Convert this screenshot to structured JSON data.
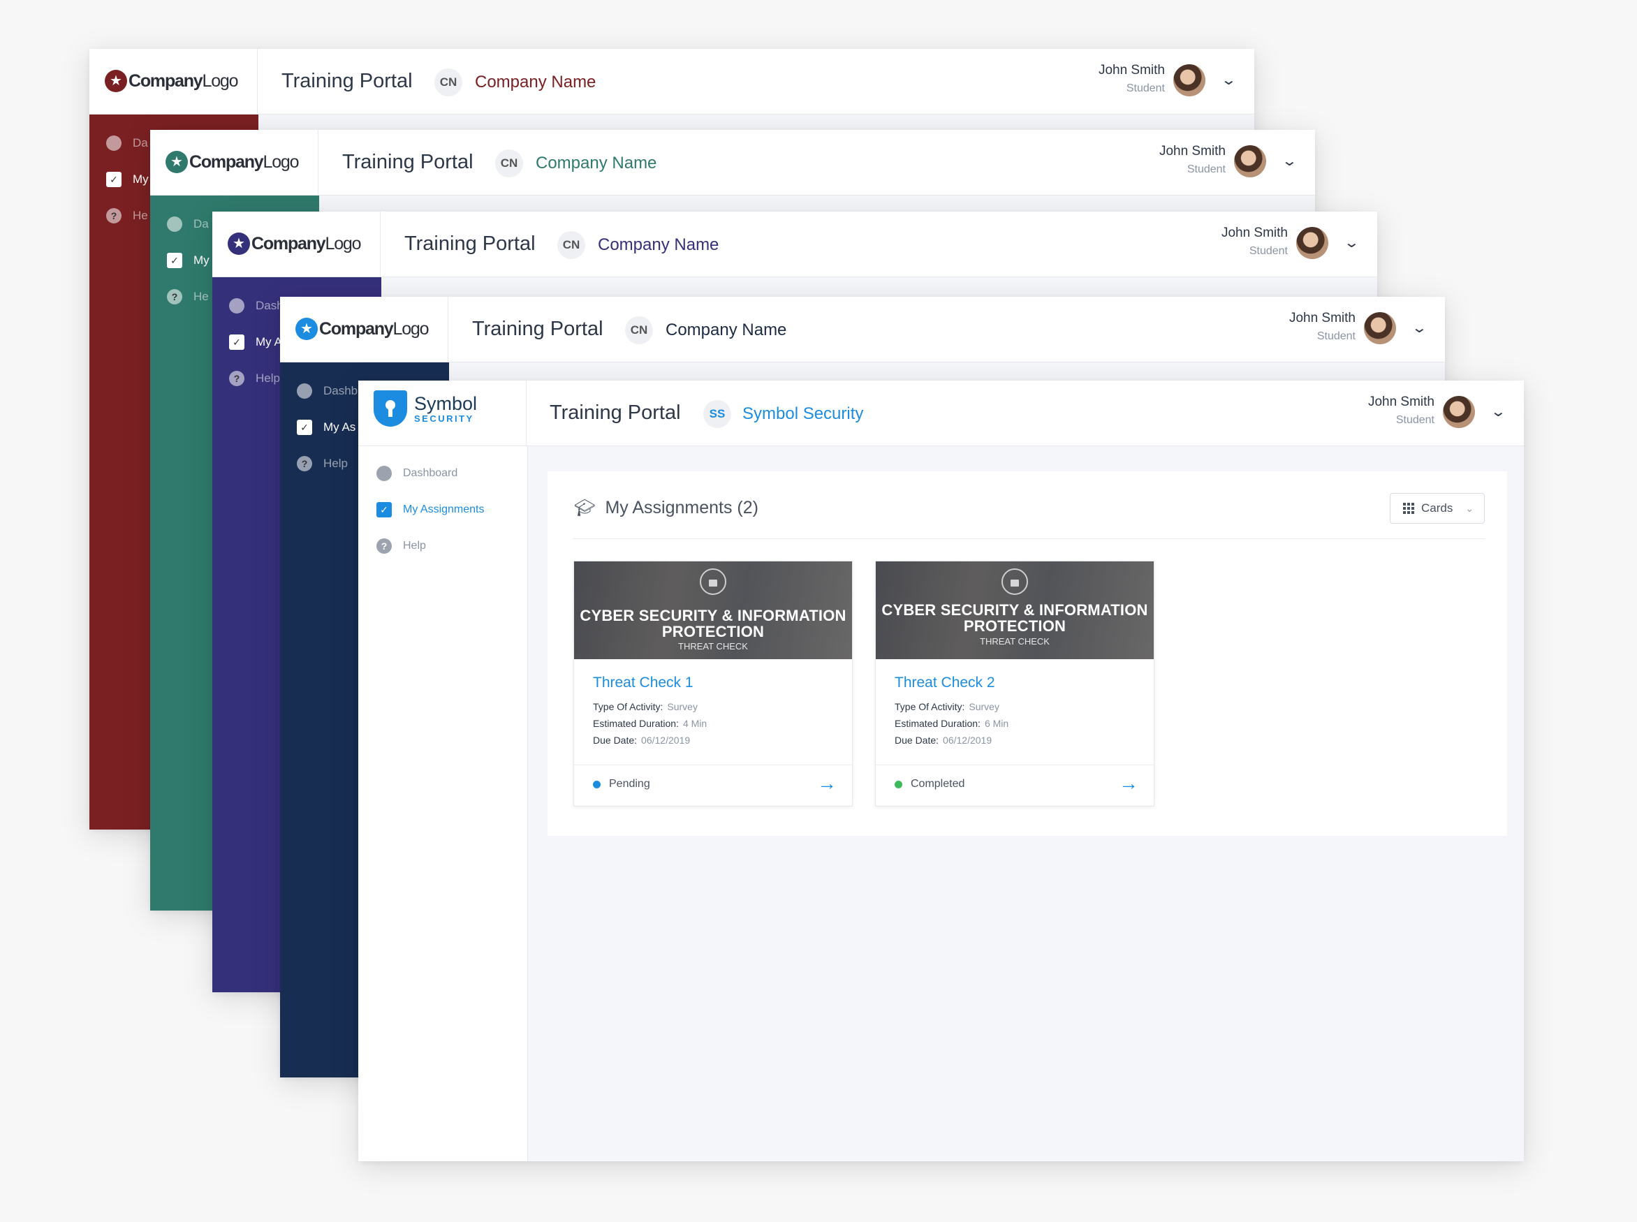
{
  "windows": [
    {
      "theme": "#7a2022",
      "logo_bold": "Company",
      "logo_thin": "Logo",
      "portal": "Training Portal",
      "badge": "CN",
      "company": "Company Name",
      "company_color": "#7a2022",
      "user": "John Smith",
      "role": "Student",
      "nav": [
        "Da",
        "My",
        "He"
      ]
    },
    {
      "theme": "#2f7a6c",
      "logo_bold": "Company",
      "logo_thin": "Logo",
      "portal": "Training Portal",
      "badge": "CN",
      "company": "Company Name",
      "company_color": "#2f7a6c",
      "user": "John Smith",
      "role": "Student",
      "nav": [
        "Da",
        "My",
        "He"
      ]
    },
    {
      "theme": "#35307a",
      "logo_bold": "Company",
      "logo_thin": "Logo",
      "portal": "Training Portal",
      "badge": "CN",
      "company": "Company Name",
      "company_color": "#35307a",
      "user": "John Smith",
      "role": "Student",
      "nav": [
        "Dash",
        "My A",
        "Help"
      ]
    },
    {
      "theme": "#172d52",
      "logo_bold": "Company",
      "logo_thin": "Logo",
      "logo_color": "#1c8ce0",
      "portal": "Training Portal",
      "badge": "CN",
      "company": "Company Name",
      "company_color": "#1d2b44",
      "user": "John Smith",
      "role": "Student",
      "nav": [
        "Dashb",
        "My As",
        "Help"
      ]
    }
  ],
  "front": {
    "logo_line1": "Symbol",
    "logo_line2": "SECURITY",
    "portal": "Training Portal",
    "badge": "SS",
    "company": "Symbol Security",
    "user": "John Smith",
    "role": "Student",
    "nav": {
      "dashboard": "Dashboard",
      "assignments": "My Assignments",
      "help": "Help"
    },
    "panel_title": "My Assignments (2)",
    "view_select": "Cards",
    "cards": [
      {
        "image_title": "CYBER SECURITY & INFORMATION PROTECTION",
        "image_subtitle": "THREAT CHECK",
        "name": "Threat Check 1",
        "activity_label": "Type Of Activity:",
        "activity": "Survey",
        "duration_label": "Estimated Duration:",
        "duration": "4 Min",
        "due_label": "Due Date:",
        "due": "06/12/2019",
        "status": "Pending",
        "status_color": "#1c8ce0"
      },
      {
        "image_title": "CYBER SECURITY & INFORMATION PROTECTION",
        "image_subtitle": "THREAT CHECK",
        "name": "Threat Check 2",
        "activity_label": "Type Of Activity:",
        "activity": "Survey",
        "duration_label": "Estimated Duration:",
        "duration": "6 Min",
        "due_label": "Due Date:",
        "due": "06/12/2019",
        "status": "Completed",
        "status_color": "#3dbb5c"
      }
    ]
  }
}
